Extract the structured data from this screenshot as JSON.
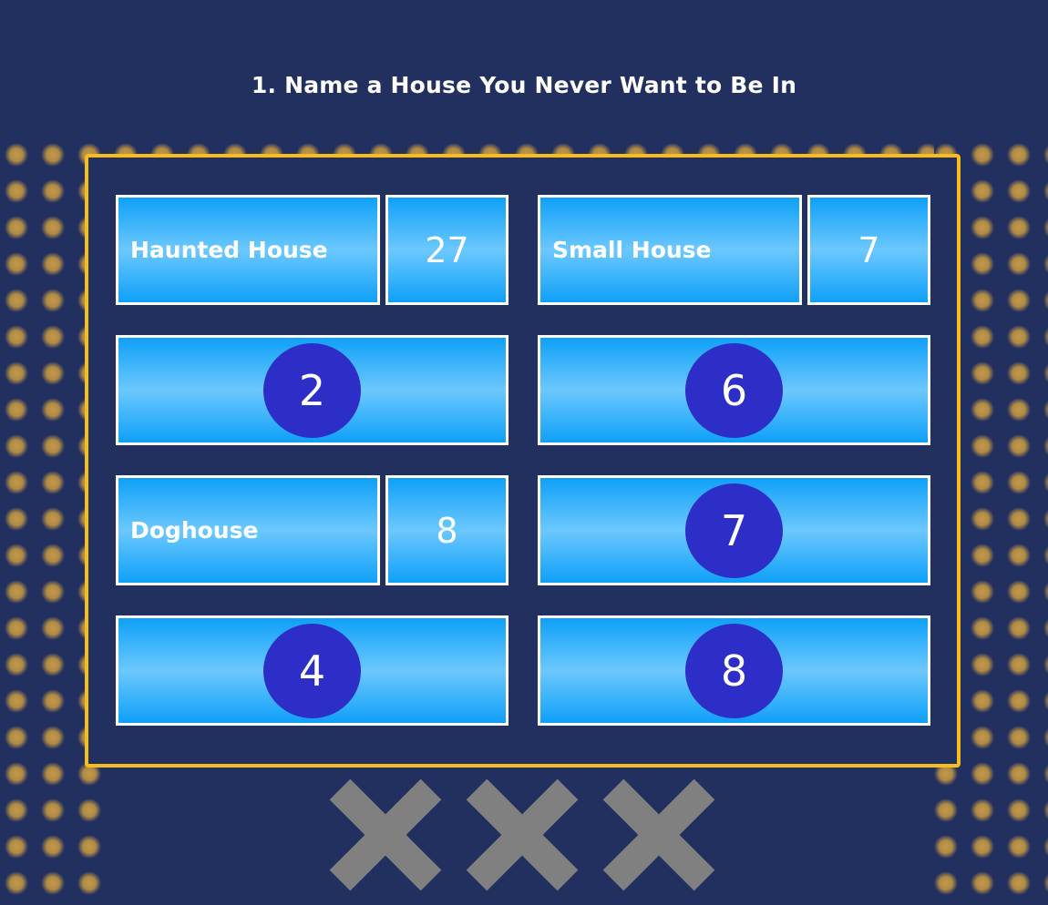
{
  "question": {
    "title": "1. Name a House You Never Want to Be In"
  },
  "board": {
    "tiles": [
      {
        "slot": 1,
        "revealed": true,
        "answer": "Haunted House",
        "points": "27"
      },
      {
        "slot": 2,
        "revealed": true,
        "answer": "Small House",
        "points": "7"
      },
      {
        "slot": 3,
        "revealed": false,
        "number": "2"
      },
      {
        "slot": 4,
        "revealed": false,
        "number": "6"
      },
      {
        "slot": 5,
        "revealed": true,
        "answer": "Doghouse",
        "points": "8"
      },
      {
        "slot": 6,
        "revealed": false,
        "number": "7"
      },
      {
        "slot": 7,
        "revealed": false,
        "number": "4"
      },
      {
        "slot": 8,
        "revealed": false,
        "number": "8"
      }
    ]
  },
  "strikes": {
    "icons": [
      "x-icon",
      "x-icon",
      "x-icon"
    ],
    "color": "#808080"
  },
  "colors": {
    "background": "#223060",
    "board_border": "#f7bd1c",
    "tile_blue": "#0fa0f8",
    "number_circle": "#2d2dc8",
    "dots": "#b08b45"
  }
}
